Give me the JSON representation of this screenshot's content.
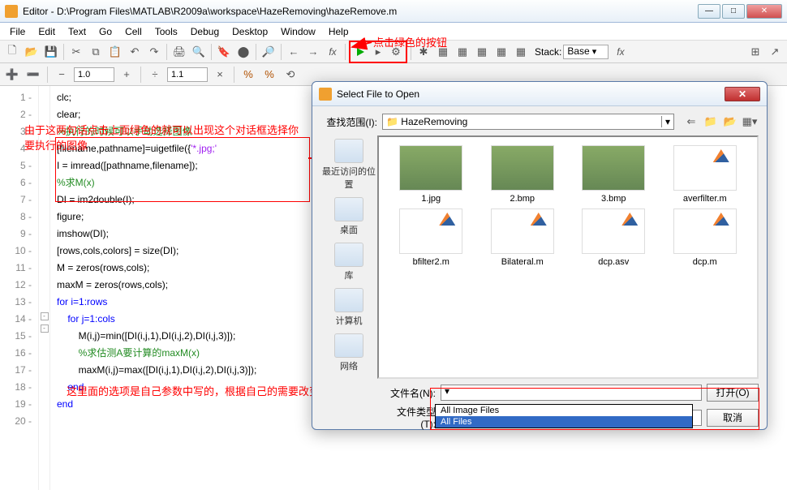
{
  "window": {
    "title": "Editor - D:\\Program Files\\MATLAB\\R2009a\\workspace\\HazeRemoving\\hazeRemove.m"
  },
  "menu": [
    "File",
    "Edit",
    "Text",
    "Go",
    "Cell",
    "Tools",
    "Debug",
    "Desktop",
    "Window",
    "Help"
  ],
  "toolbar": {
    "stack_label": "Stack:",
    "stack_value": "Base",
    "num1": "1.0",
    "num2": "1.1"
  },
  "annotations": {
    "click_green": "点击绿色的按钮",
    "two_lines": "由于这两句话点击上面绿色的就可以出现这个对话框选择你要执行的图像",
    "filetype_note": "这里面的选项是自己参数中写的，根据自己的需要改变即可"
  },
  "code_lines": [
    {
      "n": "1",
      "t": "clc;"
    },
    {
      "n": "2",
      "t": "clear;"
    },
    {
      "n": "3",
      "t": ""
    },
    {
      "n": "4",
      "t": "%执行的时候可以手动选择图像",
      "cls": "c"
    },
    {
      "n": "5",
      "t": "[filename,pathname]=uigetfile({'*.jpg;'"
    },
    {
      "n": "6",
      "t": "I = imread([pathname,filename]);"
    },
    {
      "n": "7",
      "t": "%求M(x)",
      "cls": "c"
    },
    {
      "n": "8",
      "t": "DI = im2double(I);"
    },
    {
      "n": "9",
      "t": "figure;"
    },
    {
      "n": "10",
      "t": "imshow(DI);"
    },
    {
      "n": "11",
      "t": "[rows,cols,colors] = size(DI);"
    },
    {
      "n": "12",
      "t": "M = zeros(rows,cols);"
    },
    {
      "n": "13",
      "t": "maxM = zeros(rows,cols);"
    },
    {
      "n": "14",
      "t": "for i=1:rows",
      "cls": "k"
    },
    {
      "n": "15",
      "t": "    for j=1:cols",
      "cls": "k"
    },
    {
      "n": "16",
      "t": "        M(i,j)=min([DI(i,j,1),DI(i,j,2),DI(i,j,3)]);"
    },
    {
      "n": "17",
      "t": "        %求估测A要计算的maxM(x)",
      "cls": "c"
    },
    {
      "n": "18",
      "t": "        maxM(i,j)=max([DI(i,j,1),DI(i,j,2),DI(i,j,3)]);"
    },
    {
      "n": "19",
      "t": "    end",
      "cls": "k"
    },
    {
      "n": "20",
      "t": "end",
      "cls": "k"
    }
  ],
  "dialog": {
    "title": "Select File to Open",
    "lookin_label": "查找范围(I):",
    "lookin_value": "HazeRemoving",
    "places": [
      "最近访问的位置",
      "桌面",
      "库",
      "计算机",
      "网络"
    ],
    "files": [
      {
        "name": "1.jpg",
        "kind": "img"
      },
      {
        "name": "2.bmp",
        "kind": "img"
      },
      {
        "name": "3.bmp",
        "kind": "img"
      },
      {
        "name": "averfilter.m",
        "kind": "m"
      },
      {
        "name": "bfilter2.m",
        "kind": "m"
      },
      {
        "name": "Bilateral.m",
        "kind": "m"
      },
      {
        "name": "dcp.asv",
        "kind": "m"
      },
      {
        "name": "dcp.m",
        "kind": "m"
      }
    ],
    "filename_label": "文件名(N):",
    "filename_value": "",
    "filetype_label": "文件类型(T):",
    "filetype_value": "All Files",
    "filetype_options": [
      "All Image Files",
      "All Files"
    ],
    "open_btn": "打开(O)",
    "cancel_btn": "取消"
  }
}
